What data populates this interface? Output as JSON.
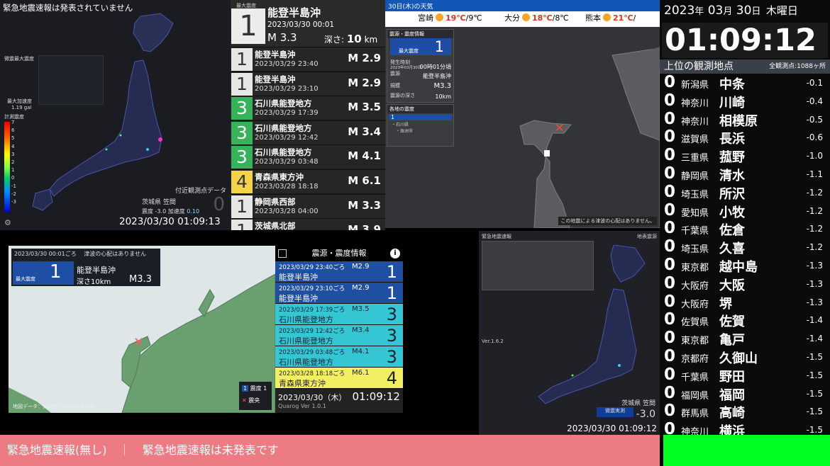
{
  "kyoshin": {
    "title": "緊急地震速報は発表されていません",
    "max_intensity_label": "微震最大震度",
    "max_accel_label": "最大加速度",
    "max_accel_value": "1.19 gal",
    "scale_label": "計測震度",
    "scale_ticks": [
      "7",
      "6",
      "5",
      "4",
      "3",
      "2",
      "1",
      "0",
      "-1",
      "-2",
      "-3"
    ],
    "nearby_label": "付近観測点データ",
    "nearby_place": "茨城県 笠間",
    "nearby_intensity_label": "震度",
    "nearby_intensity": "-3.0",
    "nearby_accel_label": "加速度",
    "nearby_accel": "0.10",
    "nearby_big": "0",
    "clock": "2023/03/30 01:09:13"
  },
  "latest": {
    "label": "最大震度",
    "intensity": "1",
    "place": "能登半島沖",
    "time": "2023/03/30  00:01",
    "mag": "M 3.3",
    "depth_label": "深さ:",
    "depth": "10",
    "depth_unit": "km"
  },
  "quakes": [
    {
      "int": "1",
      "place": "能登半島沖",
      "time": "2023/03/29  23:40",
      "mag": "M 2.9",
      "color": "#e6e6e6",
      "fg": "#333"
    },
    {
      "int": "1",
      "place": "能登半島沖",
      "time": "2023/03/29  23:10",
      "mag": "M 2.9",
      "color": "#e6e6e6",
      "fg": "#333"
    },
    {
      "int": "3",
      "place": "石川県能登地方",
      "time": "2023/03/29  17:39",
      "mag": "M 3.5",
      "color": "#36b35a",
      "fg": "#fff"
    },
    {
      "int": "3",
      "place": "石川県能登地方",
      "time": "2023/03/29  12:42",
      "mag": "M 3.4",
      "color": "#36b35a",
      "fg": "#fff"
    },
    {
      "int": "3",
      "place": "石川県能登地方",
      "time": "2023/03/29  03:48",
      "mag": "M 4.1",
      "color": "#36b35a",
      "fg": "#fff"
    },
    {
      "int": "4",
      "place": "青森県東方沖",
      "time": "2023/03/28  18:18",
      "mag": "M 6.1",
      "color": "#f3d34a",
      "fg": "#333"
    },
    {
      "int": "1",
      "place": "静岡県西部",
      "time": "2023/03/28  04:00",
      "mag": "M 3.3",
      "color": "#e6e6e6",
      "fg": "#333"
    },
    {
      "int": "1",
      "place": "茨城県北部",
      "time": "",
      "mag": "M 3.9",
      "color": "#e6e6e6",
      "fg": "#333"
    }
  ],
  "weather": {
    "header": "30日(木)の天気",
    "items": [
      {
        "city": "宮崎",
        "temp": "19℃",
        "low": "/9℃"
      },
      {
        "city": "大分",
        "temp": "18℃",
        "low": "/8℃"
      },
      {
        "city": "熊本",
        "temp": "21℃",
        "low": "/"
      }
    ]
  },
  "info": {
    "header": "震源・震度情報",
    "max_label": "最大震度",
    "max_value": "1",
    "r1_label": "発生時刻",
    "r1_sub": "2023年03月30日",
    "r1_value": "00時01分頃",
    "r2_label": "震源",
    "r2_value": "能登半島沖",
    "r3_label": "規模",
    "r3_value": "M3.3",
    "r4_label": "震源の深さ",
    "r4_value": "10km",
    "sub_header": "各地の震度",
    "sub_sel": "1",
    "sub_items": [
      "・石川県",
      "・珠洲市"
    ],
    "note": "この地震による津波の心配はありません。",
    "marker_label": "1"
  },
  "quarog": {
    "top_time": "2023/03/30 00:01ごろ",
    "top_tsunami": "津波の心配はありません",
    "int_label": "最大震度",
    "int_value": "1",
    "place": "能登半島沖",
    "depth": "深さ10km",
    "mag": "M3.3",
    "header": "震源・震度情報",
    "info_icon": "i",
    "rows": [
      {
        "time": "2023/03/29 23:40ごろ",
        "mag": "M2.9",
        "place": "能登半島沖",
        "int": "1",
        "bg": "#1f4fa0",
        "fg": "#fff"
      },
      {
        "time": "2023/03/29 23:10ごろ",
        "mag": "M2.9",
        "place": "能登半島沖",
        "int": "1",
        "bg": "#1f4fa0",
        "fg": "#fff"
      },
      {
        "time": "2023/03/29 17:39ごろ",
        "mag": "M3.5",
        "place": "石川県能登地方",
        "int": "3",
        "bg": "#34c6d2",
        "fg": "#123"
      },
      {
        "time": "2023/03/29 12:42ごろ",
        "mag": "M3.4",
        "place": "石川県能登地方",
        "int": "3",
        "bg": "#34c6d2",
        "fg": "#123"
      },
      {
        "time": "2023/03/29 03:48ごろ",
        "mag": "M4.1",
        "place": "石川県能登地方",
        "int": "3",
        "bg": "#34c6d2",
        "fg": "#123"
      },
      {
        "time": "2023/03/28 18:18ごろ",
        "mag": "M6.1",
        "place": "青森県東方沖",
        "int": "4",
        "bg": "#f3ef63",
        "fg": "#222"
      }
    ],
    "clock_date": "2023/03/30（木）",
    "clock_time": "01:09:12",
    "version": "Quarog Ver 1.0.1",
    "legend_int": "1",
    "legend_int_label": "震度 1",
    "legend_epi_label": "震央",
    "footer": "地図データ：気象庁, Natural Earth"
  },
  "eew_map": {
    "label_left": "緊急地震速報",
    "label_right": "地表震源",
    "version": "Ver.1.6.2",
    "place": "茨城県 笠間",
    "meas_label": "微震実測",
    "value": "-3.0",
    "clock": "2023/03/30  01:09:12"
  },
  "ranking": {
    "year": "2023",
    "month": "03",
    "day": "30",
    "year_unit": "年",
    "month_unit": "月",
    "day_unit": "日",
    "weekday": "木曜日",
    "time": "01:09:12",
    "header": "上位の観測地点",
    "count": "全観測点:1088ヶ所",
    "rows": [
      {
        "pref": "新潟県",
        "city": "中条",
        "v": "-0.1"
      },
      {
        "pref": "神奈川",
        "city": "川崎",
        "v": "-0.4"
      },
      {
        "pref": "神奈川",
        "city": "相模原",
        "v": "-0.5"
      },
      {
        "pref": "滋賀県",
        "city": "長浜",
        "v": "-0.6"
      },
      {
        "pref": "三重県",
        "city": "菰野",
        "v": "-1.0"
      },
      {
        "pref": "静岡県",
        "city": "清水",
        "v": "-1.1"
      },
      {
        "pref": "埼玉県",
        "city": "所沢",
        "v": "-1.2"
      },
      {
        "pref": "愛知県",
        "city": "小牧",
        "v": "-1.2"
      },
      {
        "pref": "千葉県",
        "city": "佐倉",
        "v": "-1.2"
      },
      {
        "pref": "埼玉県",
        "city": "久喜",
        "v": "-1.2"
      },
      {
        "pref": "東京都",
        "city": "越中島",
        "v": "-1.3"
      },
      {
        "pref": "大阪府",
        "city": "大阪",
        "v": "-1.3"
      },
      {
        "pref": "大阪府",
        "city": "堺",
        "v": "-1.3"
      },
      {
        "pref": "佐賀県",
        "city": "佐賀",
        "v": "-1.4"
      },
      {
        "pref": "東京都",
        "city": "亀戸",
        "v": "-1.4"
      },
      {
        "pref": "京都府",
        "city": "久御山",
        "v": "-1.5"
      },
      {
        "pref": "千葉県",
        "city": "野田",
        "v": "-1.5"
      },
      {
        "pref": "福岡県",
        "city": "福岡",
        "v": "-1.5"
      },
      {
        "pref": "群馬県",
        "city": "高崎",
        "v": "-1.5"
      },
      {
        "pref": "神奈川",
        "city": "横浜",
        "v": "-1.5"
      }
    ],
    "zero": "0"
  },
  "ticker": {
    "left": "緊急地震速報(無し)",
    "sep": "｜",
    "right": "緊急地震速報は未発表です"
  }
}
